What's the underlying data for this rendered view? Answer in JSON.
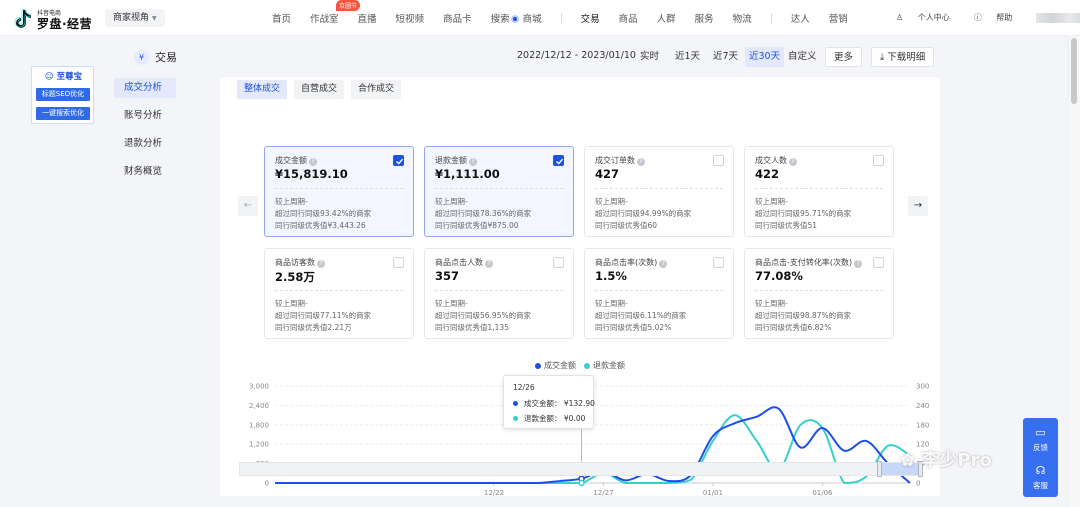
{
  "app": {
    "brand_small": "抖音电商",
    "brand": "罗盘·经营",
    "perspective": "商家视角"
  },
  "nav": {
    "items": [
      "首页",
      "作战室",
      "直播",
      "短视频",
      "商品卡",
      "搜索",
      "商城",
      "交易",
      "商品",
      "人群",
      "服务",
      "物流",
      "达人",
      "营销"
    ],
    "badge": "京圆节",
    "user_center": "个人中心",
    "help": "帮助"
  },
  "promo": {
    "title": "至尊宝",
    "btn1": "标题SEO优化",
    "btn2": "一键搜索优化"
  },
  "sidebar": {
    "header": "交易",
    "items": [
      "成交分析",
      "账号分析",
      "退款分析",
      "财务概览"
    ]
  },
  "toolbar": {
    "date_range": "2022/12/12 - 2023/01/10",
    "ranges": [
      "实时",
      "近1天",
      "近7天",
      "近30天",
      "自定义"
    ],
    "more": "更多",
    "download": "下载明细"
  },
  "tabs": [
    "整体成交",
    "自营成交",
    "合作成交"
  ],
  "metrics": [
    {
      "label": "成交金额",
      "value": "¥15,819.10",
      "checked": true,
      "sub1": "较上周期-",
      "sub2": "超过同行同级93.42%的商家",
      "sub3": "同行同级优秀值¥3,443.26"
    },
    {
      "label": "退款金额",
      "value": "¥1,111.00",
      "checked": true,
      "sub1": "较上周期-",
      "sub2": "超过同行同级78.36%的商家",
      "sub3": "同行同级优秀值¥875.00"
    },
    {
      "label": "成交订单数",
      "value": "427",
      "checked": false,
      "sub1": "较上周期-",
      "sub2": "超过同行同级94.99%的商家",
      "sub3": "同行同级优秀值60"
    },
    {
      "label": "成交人数",
      "value": "422",
      "checked": false,
      "sub1": "较上周期-",
      "sub2": "超过同行同级95.71%的商家",
      "sub3": "同行同级优秀值51"
    },
    {
      "label": "商品访客数",
      "value": "2.58万",
      "checked": false,
      "sub1": "较上周期-",
      "sub2": "超过同行同级77.11%的商家",
      "sub3": "同行同级优秀值2.21万"
    },
    {
      "label": "商品点击人数",
      "value": "357",
      "checked": false,
      "sub1": "较上周期-",
      "sub2": "超过同行同级56.95%的商家",
      "sub3": "同行同级优秀值1,135"
    },
    {
      "label": "商品点击率(次数)",
      "value": "1.5%",
      "checked": false,
      "sub1": "较上周期-",
      "sub2": "超过同行同级6.11%的商家",
      "sub3": "同行同级优秀值5.02%"
    },
    {
      "label": "商品点击-支付转化率(次数)",
      "value": "77.08%",
      "checked": false,
      "sub1": "较上周期-",
      "sub2": "超过同行同级98.87%的商家",
      "sub3": "同行同级优秀值6.82%"
    }
  ],
  "chart_data": {
    "type": "line",
    "x": [
      "12/12",
      "12/13",
      "12/14",
      "12/15",
      "12/16",
      "12/17",
      "12/18",
      "12/19",
      "12/20",
      "12/21",
      "12/22",
      "12/23",
      "12/24",
      "12/25",
      "12/26",
      "12/27",
      "12/28",
      "12/29",
      "12/30",
      "12/31",
      "01/01",
      "01/02",
      "01/03",
      "01/04",
      "01/05",
      "01/06",
      "01/07",
      "01/08",
      "01/09",
      "01/10"
    ],
    "xticks": [
      "12/22",
      "12/27",
      "01/01",
      "01/06"
    ],
    "series": [
      {
        "name": "成交金额",
        "axis": "left",
        "color": "#1d4fe6",
        "values": [
          0,
          0,
          0,
          0,
          0,
          0,
          0,
          0,
          0,
          0,
          0,
          0,
          0,
          60,
          132.9,
          360,
          80,
          280,
          60,
          250,
          1450,
          1850,
          2050,
          2300,
          1100,
          1700,
          1000,
          1300,
          600,
          0
        ]
      },
      {
        "name": "退款金额",
        "axis": "right",
        "color": "#36cfc9",
        "values": [
          0,
          0,
          0,
          0,
          0,
          0,
          0,
          0,
          0,
          0,
          0,
          0,
          0,
          0,
          0,
          30,
          0,
          0,
          0,
          10,
          130,
          210,
          130,
          40,
          180,
          170,
          0,
          20,
          115,
          85
        ]
      }
    ],
    "y_left": {
      "ticks": [
        "0",
        "600",
        "1,200",
        "1,800",
        "2,400",
        "3,000"
      ],
      "ylim": [
        0,
        3000
      ]
    },
    "y_right": {
      "ticks": [
        "0",
        "60",
        "120",
        "180",
        "240",
        "300"
      ],
      "ylim": [
        0,
        300
      ]
    },
    "legend": "top-center",
    "grid": true
  },
  "tooltip": {
    "date": "12/26",
    "row1_label": "成交金额：",
    "row1_value": "¥132.90",
    "row2_label": "退款金额：",
    "row2_value": "¥0.00"
  },
  "right": {
    "feedback": "反馈",
    "service": "客服",
    "watermark": "李少Pro"
  },
  "colors": {
    "accent": "#1d52e0",
    "series1": "#1d4fe6",
    "series2": "#36cfc9"
  }
}
